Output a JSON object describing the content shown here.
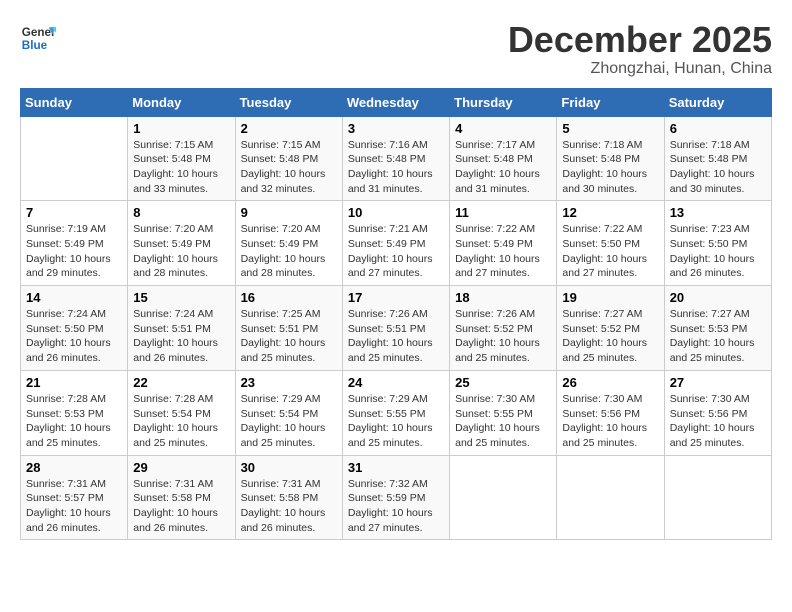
{
  "header": {
    "logo_line1": "General",
    "logo_line2": "Blue",
    "month": "December 2025",
    "location": "Zhongzhai, Hunan, China"
  },
  "days_of_week": [
    "Sunday",
    "Monday",
    "Tuesday",
    "Wednesday",
    "Thursday",
    "Friday",
    "Saturday"
  ],
  "weeks": [
    [
      {
        "num": "",
        "info": ""
      },
      {
        "num": "1",
        "info": "Sunrise: 7:15 AM\nSunset: 5:48 PM\nDaylight: 10 hours\nand 33 minutes."
      },
      {
        "num": "2",
        "info": "Sunrise: 7:15 AM\nSunset: 5:48 PM\nDaylight: 10 hours\nand 32 minutes."
      },
      {
        "num": "3",
        "info": "Sunrise: 7:16 AM\nSunset: 5:48 PM\nDaylight: 10 hours\nand 31 minutes."
      },
      {
        "num": "4",
        "info": "Sunrise: 7:17 AM\nSunset: 5:48 PM\nDaylight: 10 hours\nand 31 minutes."
      },
      {
        "num": "5",
        "info": "Sunrise: 7:18 AM\nSunset: 5:48 PM\nDaylight: 10 hours\nand 30 minutes."
      },
      {
        "num": "6",
        "info": "Sunrise: 7:18 AM\nSunset: 5:48 PM\nDaylight: 10 hours\nand 30 minutes."
      }
    ],
    [
      {
        "num": "7",
        "info": "Sunrise: 7:19 AM\nSunset: 5:49 PM\nDaylight: 10 hours\nand 29 minutes."
      },
      {
        "num": "8",
        "info": "Sunrise: 7:20 AM\nSunset: 5:49 PM\nDaylight: 10 hours\nand 28 minutes."
      },
      {
        "num": "9",
        "info": "Sunrise: 7:20 AM\nSunset: 5:49 PM\nDaylight: 10 hours\nand 28 minutes."
      },
      {
        "num": "10",
        "info": "Sunrise: 7:21 AM\nSunset: 5:49 PM\nDaylight: 10 hours\nand 27 minutes."
      },
      {
        "num": "11",
        "info": "Sunrise: 7:22 AM\nSunset: 5:49 PM\nDaylight: 10 hours\nand 27 minutes."
      },
      {
        "num": "12",
        "info": "Sunrise: 7:22 AM\nSunset: 5:50 PM\nDaylight: 10 hours\nand 27 minutes."
      },
      {
        "num": "13",
        "info": "Sunrise: 7:23 AM\nSunset: 5:50 PM\nDaylight: 10 hours\nand 26 minutes."
      }
    ],
    [
      {
        "num": "14",
        "info": "Sunrise: 7:24 AM\nSunset: 5:50 PM\nDaylight: 10 hours\nand 26 minutes."
      },
      {
        "num": "15",
        "info": "Sunrise: 7:24 AM\nSunset: 5:51 PM\nDaylight: 10 hours\nand 26 minutes."
      },
      {
        "num": "16",
        "info": "Sunrise: 7:25 AM\nSunset: 5:51 PM\nDaylight: 10 hours\nand 25 minutes."
      },
      {
        "num": "17",
        "info": "Sunrise: 7:26 AM\nSunset: 5:51 PM\nDaylight: 10 hours\nand 25 minutes."
      },
      {
        "num": "18",
        "info": "Sunrise: 7:26 AM\nSunset: 5:52 PM\nDaylight: 10 hours\nand 25 minutes."
      },
      {
        "num": "19",
        "info": "Sunrise: 7:27 AM\nSunset: 5:52 PM\nDaylight: 10 hours\nand 25 minutes."
      },
      {
        "num": "20",
        "info": "Sunrise: 7:27 AM\nSunset: 5:53 PM\nDaylight: 10 hours\nand 25 minutes."
      }
    ],
    [
      {
        "num": "21",
        "info": "Sunrise: 7:28 AM\nSunset: 5:53 PM\nDaylight: 10 hours\nand 25 minutes."
      },
      {
        "num": "22",
        "info": "Sunrise: 7:28 AM\nSunset: 5:54 PM\nDaylight: 10 hours\nand 25 minutes."
      },
      {
        "num": "23",
        "info": "Sunrise: 7:29 AM\nSunset: 5:54 PM\nDaylight: 10 hours\nand 25 minutes."
      },
      {
        "num": "24",
        "info": "Sunrise: 7:29 AM\nSunset: 5:55 PM\nDaylight: 10 hours\nand 25 minutes."
      },
      {
        "num": "25",
        "info": "Sunrise: 7:30 AM\nSunset: 5:55 PM\nDaylight: 10 hours\nand 25 minutes."
      },
      {
        "num": "26",
        "info": "Sunrise: 7:30 AM\nSunset: 5:56 PM\nDaylight: 10 hours\nand 25 minutes."
      },
      {
        "num": "27",
        "info": "Sunrise: 7:30 AM\nSunset: 5:56 PM\nDaylight: 10 hours\nand 25 minutes."
      }
    ],
    [
      {
        "num": "28",
        "info": "Sunrise: 7:31 AM\nSunset: 5:57 PM\nDaylight: 10 hours\nand 26 minutes."
      },
      {
        "num": "29",
        "info": "Sunrise: 7:31 AM\nSunset: 5:58 PM\nDaylight: 10 hours\nand 26 minutes."
      },
      {
        "num": "30",
        "info": "Sunrise: 7:31 AM\nSunset: 5:58 PM\nDaylight: 10 hours\nand 26 minutes."
      },
      {
        "num": "31",
        "info": "Sunrise: 7:32 AM\nSunset: 5:59 PM\nDaylight: 10 hours\nand 27 minutes."
      },
      {
        "num": "",
        "info": ""
      },
      {
        "num": "",
        "info": ""
      },
      {
        "num": "",
        "info": ""
      }
    ]
  ]
}
